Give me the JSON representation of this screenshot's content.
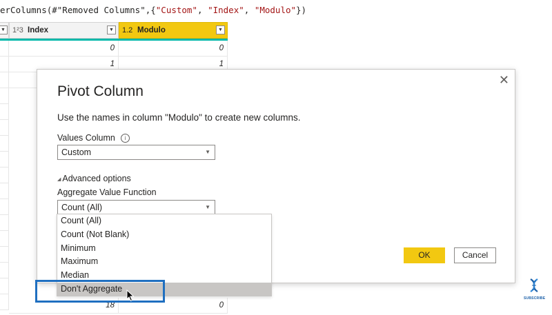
{
  "formula": {
    "prefix": "erColumns(#\"Removed Columns\",{",
    "s1": "\"Custom\"",
    "sep1": ", ",
    "s2": "\"Index\"",
    "sep2": ", ",
    "s3": "\"Modulo\"",
    "suffix": "})"
  },
  "grid": {
    "index_header": {
      "type": "1²3",
      "label": "Index"
    },
    "modulo_header": {
      "type": "1.2",
      "label": "Modulo"
    },
    "index_values": [
      "0",
      "1"
    ],
    "modulo_values": [
      "0",
      "1"
    ],
    "bottom_index_value": "18",
    "bottom_modulo_value": "0"
  },
  "dialog": {
    "title": "Pivot Column",
    "description": "Use the names in column \"Modulo\" to create new columns.",
    "values_column_label": "Values Column",
    "values_column_selected": "Custom",
    "advanced_options_label": "Advanced options",
    "aggregate_label": "Aggregate Value Function",
    "aggregate_selected": "Count (All)",
    "aggregate_options": [
      "Count (All)",
      "Count (Not Blank)",
      "Minimum",
      "Maximum",
      "Median",
      "Don't Aggregate"
    ],
    "highlighted_option": "Don't Aggregate",
    "ok_label": "OK",
    "cancel_label": "Cancel"
  },
  "logo_text": "SUBSCRIBE",
  "colors": {
    "accent": "#f2c811",
    "teal": "#01b8aa",
    "focus": "#1f6fc0"
  }
}
